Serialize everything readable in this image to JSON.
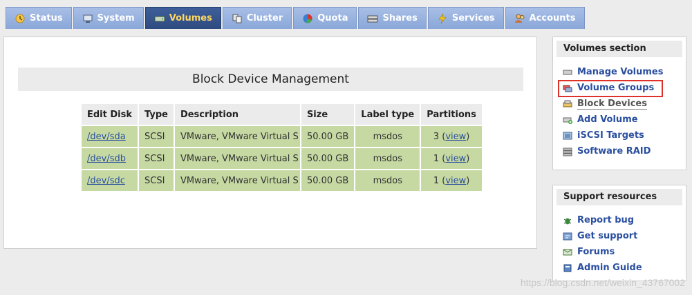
{
  "tabs": [
    {
      "label": "Status",
      "icon": "status-icon"
    },
    {
      "label": "System",
      "icon": "system-icon"
    },
    {
      "label": "Volumes",
      "icon": "volumes-icon",
      "active": true
    },
    {
      "label": "Cluster",
      "icon": "cluster-icon"
    },
    {
      "label": "Quota",
      "icon": "quota-icon"
    },
    {
      "label": "Shares",
      "icon": "shares-icon"
    },
    {
      "label": "Services",
      "icon": "services-icon"
    },
    {
      "label": "Accounts",
      "icon": "accounts-icon"
    }
  ],
  "main": {
    "title": "Block Device Management",
    "table": {
      "headers": [
        "Edit Disk",
        "Type",
        "Description",
        "Size",
        "Label type",
        "Partitions"
      ],
      "rows": [
        {
          "disk": "/dev/sda",
          "type": "SCSI",
          "description": "VMware, VMware Virtual S",
          "size": "50.00 GB",
          "label_type": "msdos",
          "partitions_count": "3",
          "view_label": "view"
        },
        {
          "disk": "/dev/sdb",
          "type": "SCSI",
          "description": "VMware, VMware Virtual S",
          "size": "50.00 GB",
          "label_type": "msdos",
          "partitions_count": "1",
          "view_label": "view"
        },
        {
          "disk": "/dev/sdc",
          "type": "SCSI",
          "description": "VMware, VMware Virtual S",
          "size": "50.00 GB",
          "label_type": "msdos",
          "partitions_count": "1",
          "view_label": "view"
        }
      ]
    }
  },
  "sidebar": {
    "volumes_section": {
      "title": "Volumes section",
      "items": [
        {
          "label": "Manage Volumes",
          "icon": "disk-icon"
        },
        {
          "label": "Volume Groups",
          "icon": "volume-group-icon",
          "highlighted": true
        },
        {
          "label": "Block Devices",
          "icon": "block-device-icon",
          "current": true
        },
        {
          "label": "Add Volume",
          "icon": "add-volume-icon"
        },
        {
          "label": "iSCSI Targets",
          "icon": "iscsi-icon"
        },
        {
          "label": "Software RAID",
          "icon": "raid-icon"
        }
      ]
    },
    "support": {
      "title": "Support resources",
      "items": [
        {
          "label": "Report bug",
          "icon": "bug-icon"
        },
        {
          "label": "Get support",
          "icon": "support-icon"
        },
        {
          "label": "Forums",
          "icon": "forums-icon"
        },
        {
          "label": "Admin Guide",
          "icon": "book-icon"
        }
      ]
    }
  },
  "watermark": "https://blog.csdn.net/weixin_43767002",
  "colors": {
    "tab_bg": "#8aa7d9",
    "tab_active_bg": "#2e4b80",
    "tab_active_text": "#ffd860",
    "row_bg": "#c6d9a3",
    "link": "#2a4fa0",
    "highlight": "#e0302a"
  }
}
